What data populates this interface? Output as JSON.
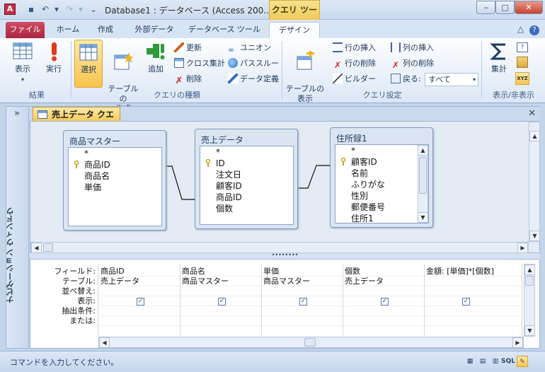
{
  "window": {
    "title": "Database1 : データベース (Access 200...",
    "context_tools": "クエリ ツール",
    "icon_letter": "A"
  },
  "window_buttons": {
    "minimize": "‒",
    "maximize": "□",
    "close": "✕"
  },
  "tabs": [
    "ファイル",
    "ホーム",
    "作成",
    "外部データ",
    "データベース ツール",
    "デザイン"
  ],
  "ribbon": {
    "groups": {
      "results": "結果",
      "query_type": "クエリの種類",
      "query_setup": "クエリ設定",
      "show_hide": "表示/非表示"
    },
    "view": "表示",
    "run": "実行",
    "select": "選択",
    "make_table": "テーブルの\n作成",
    "append": "追加",
    "update": "更新",
    "crosstab": "クロス集計",
    "delete": "削除",
    "union": "ユニオン",
    "passthrough": "パススルー",
    "data_definition": "データ定義",
    "show_table": "テーブルの\n表示",
    "insert_rows": "行の挿入",
    "delete_rows": "行の削除",
    "builder": "ビルダー",
    "insert_cols": "列の挿入",
    "delete_cols": "列の削除",
    "return_label": "戻る:",
    "return_value": "すべて",
    "totals": "集計"
  },
  "nav": {
    "toggle": "»",
    "label": "ナビゲーション ウィンドウ"
  },
  "doc": {
    "tab": "売上データ クエリ",
    "close": "✕"
  },
  "tables": [
    {
      "title": "商品マスター",
      "fields": [
        "*",
        "商品ID",
        "商品名",
        "単価"
      ]
    },
    {
      "title": "売上データ",
      "fields": [
        "*",
        "ID",
        "注文日",
        "顧客ID",
        "商品ID",
        "個数"
      ]
    },
    {
      "title": "住所録1",
      "fields": [
        "*",
        "顧客ID",
        "名前",
        "ふりがな",
        "性別",
        "郵便番号",
        "住所1"
      ]
    }
  ],
  "grid": {
    "row_labels": [
      "フィールド:",
      "テーブル:",
      "並べ替え:",
      "表示:",
      "抽出条件:",
      "または:"
    ],
    "columns": [
      {
        "field": "商品ID",
        "table": "売上データ",
        "show": true
      },
      {
        "field": "商品名",
        "table": "商品マスター",
        "show": true
      },
      {
        "field": "単価",
        "table": "商品マスター",
        "show": true
      },
      {
        "field": "個数",
        "table": "売上データ",
        "show": true
      },
      {
        "field": "金額: [単価]*[個数]",
        "table": "",
        "show": true
      }
    ]
  },
  "status": {
    "text": "コマンドを入力してください。",
    "view_sql": "SQL"
  }
}
